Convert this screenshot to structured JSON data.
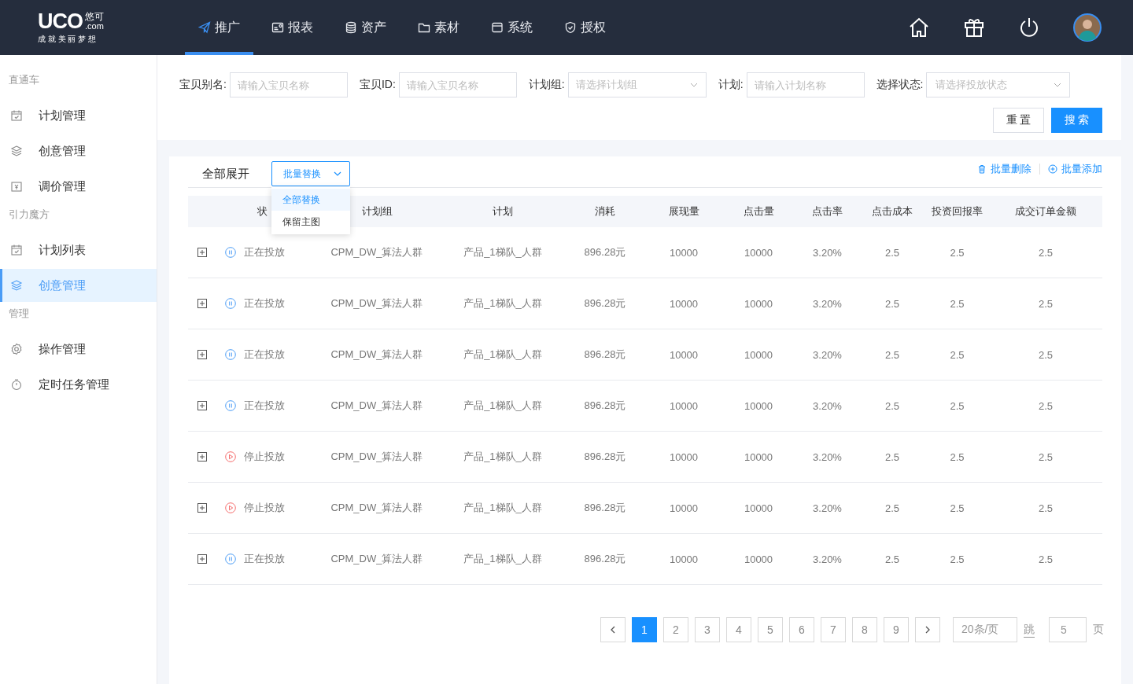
{
  "logo": {
    "mark": "UCO",
    "name": "悠可",
    "domain": ".com",
    "slogan": "成 就 美 丽 梦 想"
  },
  "nav": [
    {
      "label": "推广",
      "kind": "plane",
      "selected": true
    },
    {
      "label": "报表",
      "kind": "report",
      "selected": false
    },
    {
      "label": "资产",
      "kind": "database",
      "selected": false
    },
    {
      "label": "素材",
      "kind": "folder",
      "selected": false
    },
    {
      "label": "系统",
      "kind": "window",
      "selected": false
    },
    {
      "label": "授权",
      "kind": "shield",
      "selected": false
    }
  ],
  "sidebar": [
    {
      "title": "直通车",
      "items": [
        {
          "label": "计划管理",
          "kind": "calendar",
          "selected": false
        },
        {
          "label": "创意管理",
          "kind": "layers",
          "selected": false
        },
        {
          "label": "调价管理",
          "kind": "price",
          "selected": false
        }
      ]
    },
    {
      "title": "引力魔方",
      "items": [
        {
          "label": "计划列表",
          "kind": "calendar",
          "selected": false
        },
        {
          "label": "创意管理",
          "kind": "layers",
          "selected": true
        }
      ]
    },
    {
      "title": "管理",
      "items": [
        {
          "label": "操作管理",
          "kind": "gear",
          "selected": false
        },
        {
          "label": "定时任务管理",
          "kind": "timer",
          "selected": false
        }
      ]
    }
  ],
  "filters": [
    {
      "label": "宝贝别名:",
      "kind": "input",
      "placeholder": "请输入宝贝名称"
    },
    {
      "label": "宝贝ID:",
      "kind": "input",
      "placeholder": "请输入宝贝名称"
    },
    {
      "label": "计划组:",
      "kind": "select",
      "placeholder": "请选择计划组"
    },
    {
      "label": "计划:",
      "kind": "input",
      "placeholder": "请输入计划名称"
    },
    {
      "label": "选择状态:",
      "kind": "select",
      "placeholder": "请选择投放状态"
    }
  ],
  "filter_buttons": [
    "重 置",
    "搜 索"
  ],
  "toolbar": {
    "expand_all": "全部展开",
    "batch_replace": {
      "label": "批量替换",
      "options": [
        {
          "label": "全部替换",
          "selected": true
        },
        {
          "label": "保留主图",
          "selected": false
        }
      ]
    },
    "batch_delete": "批量删除",
    "batch_add": "批量添加"
  },
  "table": {
    "columns": [
      "状",
      "计划组",
      "计划",
      "消耗",
      "展现量",
      "点击量",
      "点击率",
      "点击成本",
      "投资回报率",
      "成交订单金额"
    ],
    "rows": [
      {
        "kind": "running",
        "cells": [
          "正在投放",
          "CPM_DW_算法人群",
          "产品_1梯队_人群",
          "896.28元",
          "10000",
          "10000",
          "3.20%",
          "2.5",
          "2.5",
          "2.5"
        ]
      },
      {
        "kind": "running",
        "cells": [
          "正在投放",
          "CPM_DW_算法人群",
          "产品_1梯队_人群",
          "896.28元",
          "10000",
          "10000",
          "3.20%",
          "2.5",
          "2.5",
          "2.5"
        ]
      },
      {
        "kind": "running",
        "cells": [
          "正在投放",
          "CPM_DW_算法人群",
          "产品_1梯队_人群",
          "896.28元",
          "10000",
          "10000",
          "3.20%",
          "2.5",
          "2.5",
          "2.5"
        ]
      },
      {
        "kind": "running",
        "cells": [
          "正在投放",
          "CPM_DW_算法人群",
          "产品_1梯队_人群",
          "896.28元",
          "10000",
          "10000",
          "3.20%",
          "2.5",
          "2.5",
          "2.5"
        ]
      },
      {
        "kind": "stopped",
        "cells": [
          "停止投放",
          "CPM_DW_算法人群",
          "产品_1梯队_人群",
          "896.28元",
          "10000",
          "10000",
          "3.20%",
          "2.5",
          "2.5",
          "2.5"
        ]
      },
      {
        "kind": "stopped",
        "cells": [
          "停止投放",
          "CPM_DW_算法人群",
          "产品_1梯队_人群",
          "896.28元",
          "10000",
          "10000",
          "3.20%",
          "2.5",
          "2.5",
          "2.5"
        ]
      },
      {
        "kind": "running",
        "cells": [
          "正在投放",
          "CPM_DW_算法人群",
          "产品_1梯队_人群",
          "896.28元",
          "10000",
          "10000",
          "3.20%",
          "2.5",
          "2.5",
          "2.5"
        ]
      }
    ]
  },
  "pagination": {
    "pages": [
      {
        "label": "1",
        "selected": true
      },
      {
        "label": "2",
        "selected": false
      },
      {
        "label": "3",
        "selected": false
      },
      {
        "label": "4",
        "selected": false
      },
      {
        "label": "5",
        "selected": false
      },
      {
        "label": "6",
        "selected": false
      },
      {
        "label": "7",
        "selected": false
      },
      {
        "label": "8",
        "selected": false
      },
      {
        "label": "9",
        "selected": false
      }
    ],
    "page_size": "20条/页",
    "jump_label": "跳",
    "jump_value": "5",
    "page_suffix": "页"
  }
}
